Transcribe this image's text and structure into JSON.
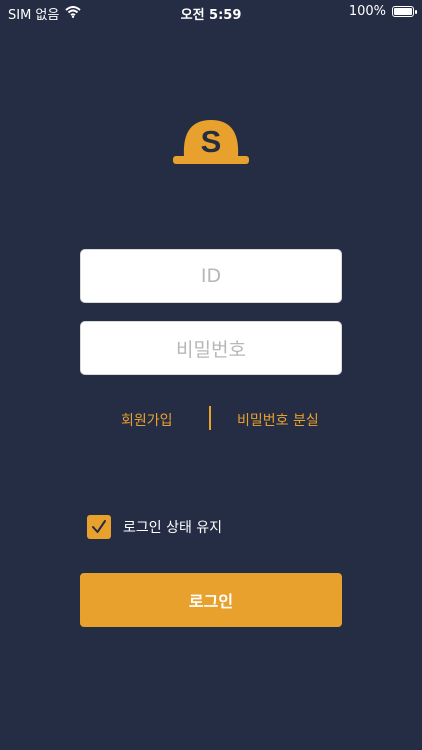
{
  "status_bar": {
    "carrier": "SIM 없음",
    "time": "오전 5:59",
    "battery_percent": "100%",
    "icons": [
      "wifi-icon",
      "battery-icon"
    ]
  },
  "logo": {
    "letter": "S",
    "icon": "hard-hat-logo-icon"
  },
  "form": {
    "id_placeholder": "ID",
    "password_placeholder": "비밀번호"
  },
  "links": {
    "signup": "회원가입",
    "lost_password": "비밀번호 분실"
  },
  "keep_login": {
    "label": "로그인 상태 유지",
    "checked": true
  },
  "login_button": {
    "label": "로그인"
  },
  "colors": {
    "background": "#252d45",
    "accent": "#e8a12c",
    "input_bg": "#ffffff",
    "placeholder": "#b7b7b7"
  }
}
